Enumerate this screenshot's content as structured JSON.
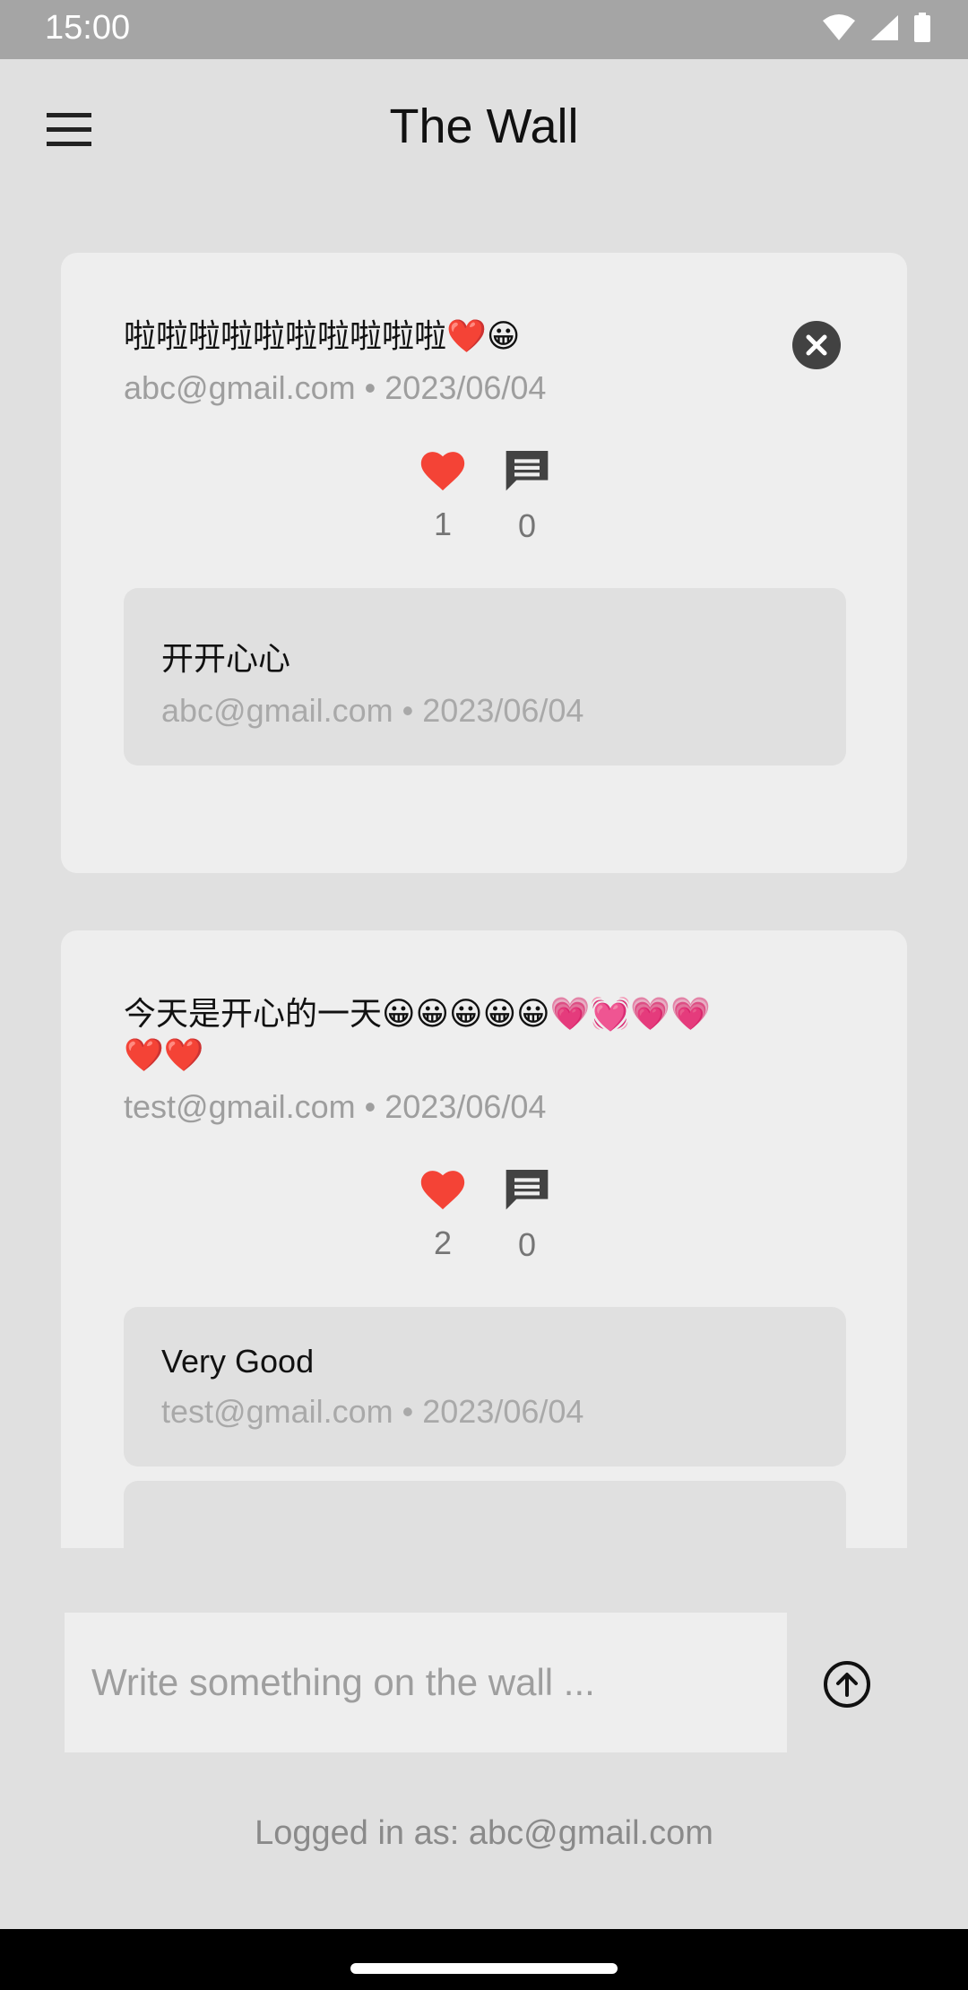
{
  "status_bar": {
    "time": "15:00"
  },
  "app_bar": {
    "title": "The Wall"
  },
  "posts": [
    {
      "message": "啦啦啦啦啦啦啦啦啦啦❤️😀",
      "user": "abc@gmail.com",
      "date": "2023/06/04",
      "likes": "1",
      "comments_count": "0",
      "deletable": true,
      "comments": [
        {
          "text": "开开心心",
          "user": "abc@gmail.com",
          "date": "2023/06/04"
        }
      ]
    },
    {
      "message": "今天是开心的一天😀😀😀😀😀💗💓💗💗❤️❤️",
      "user": "test@gmail.com",
      "date": "2023/06/04",
      "likes": "2",
      "comments_count": "0",
      "deletable": false,
      "comments": [
        {
          "text": "Very Good",
          "user": "test@gmail.com",
          "date": "2023/06/04"
        }
      ]
    }
  ],
  "meta_separator": "•",
  "composer": {
    "placeholder": "Write something on the wall ..."
  },
  "footer": {
    "logged_in": "Logged in as: abc@gmail.com"
  },
  "colors": {
    "like_red": "#f44336",
    "icon_dark": "#424242",
    "card_bg": "#eeeeee",
    "page_bg": "#e0e0e0"
  }
}
